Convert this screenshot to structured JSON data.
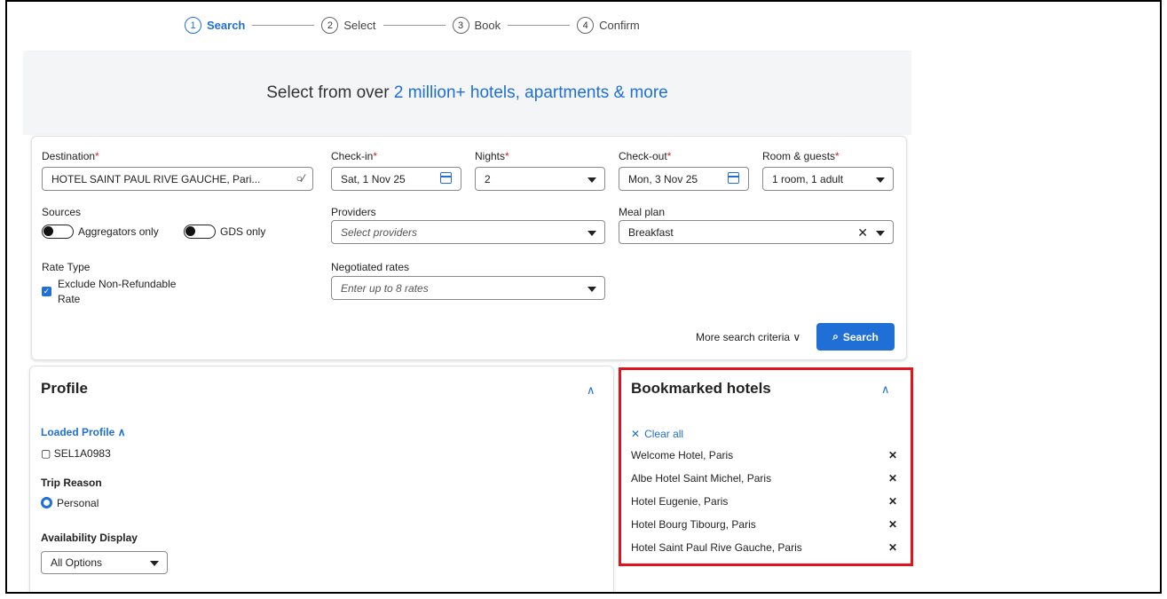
{
  "stepper": {
    "steps": [
      {
        "num": "1",
        "label": "Search"
      },
      {
        "num": "2",
        "label": "Select"
      },
      {
        "num": "3",
        "label": "Book"
      },
      {
        "num": "4",
        "label": "Confirm"
      }
    ],
    "active_step": "Search"
  },
  "hero": {
    "title_prefix": "Select from over ",
    "title_highlight": "2 million+ hotels, apartments & more"
  },
  "search": {
    "destination_label": "Destination",
    "destination_value": "HOTEL SAINT PAUL RIVE GAUCHE, Pari...",
    "checkin_label": "Check-in",
    "checkin_value": "Sat, 1 Nov 25",
    "nights_label": "Nights",
    "nights_value": "2",
    "checkout_label": "Check-out",
    "checkout_value": "Mon, 3 Nov 25",
    "room_label": "Room & guests",
    "room_value": "1 room, 1 adult",
    "required_mark": "*",
    "sources_label": "Sources",
    "toggle_aggregators": "Aggregators only",
    "toggle_gds": "GDS only",
    "providers_label": "Providers",
    "providers_placeholder": "Select providers",
    "meal_label": "Meal plan",
    "meal_value": "Breakfast",
    "rate_type_label": "Rate Type",
    "exclude_line1": "Exclude Non-Refundable",
    "exclude_line2": "Rate",
    "negotiated_label": "Negotiated rates",
    "negotiated_placeholder": "Enter up to 8 rates",
    "more_criteria": "More search criteria",
    "search_button": "Search"
  },
  "profile": {
    "title": "Profile",
    "loaded_profile": "Loaded Profile",
    "profile_id": "SEL1A0983",
    "trip_reason_label": "Trip Reason",
    "trip_reason_value": "Personal",
    "availability_label": "Availability Display",
    "availability_value": "All Options"
  },
  "bookmarks": {
    "title": "Bookmarked hotels",
    "clear_all": "Clear all",
    "items": [
      "Welcome Hotel, Paris",
      "Albe Hotel Saint Michel, Paris",
      "Hotel Eugenie, Paris",
      "Hotel Bourg Tibourg, Paris",
      "Hotel Saint Paul Rive Gauche, Paris"
    ]
  },
  "colors": {
    "accent": "#1f6fd6",
    "required": "#d6232a",
    "highlight_border": "#e3131b"
  }
}
